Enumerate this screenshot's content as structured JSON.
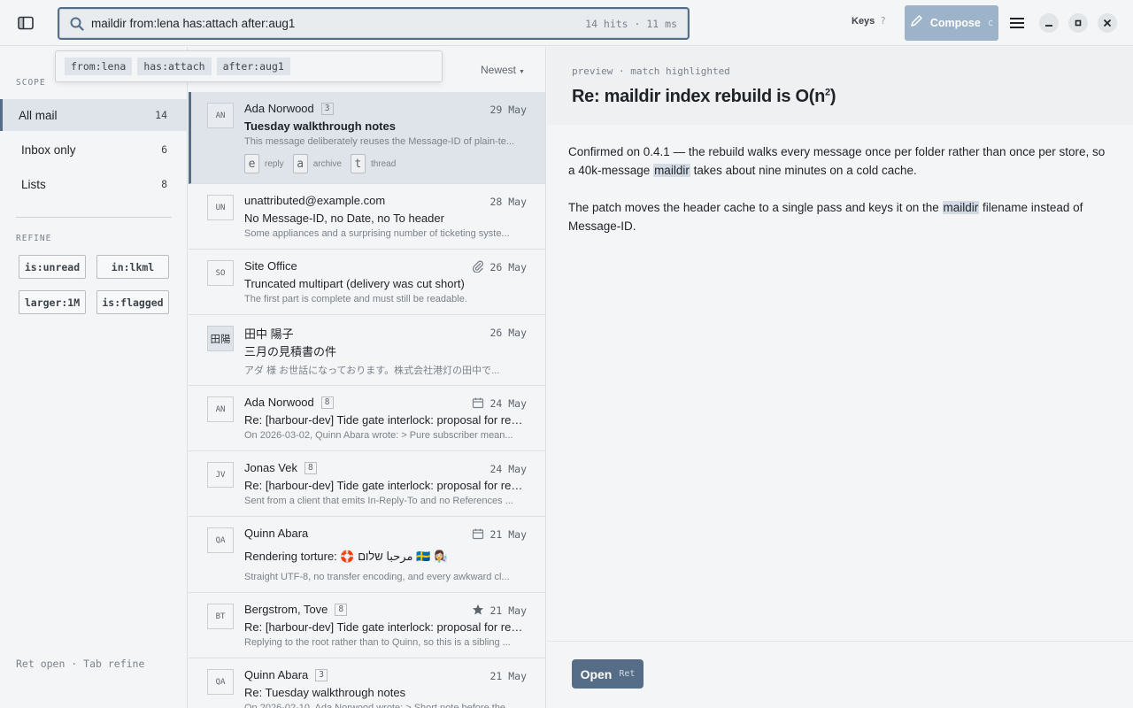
{
  "search": {
    "query": "maildir from:lena has:attach after:aug1",
    "stats": "14 hits · 11 ms",
    "suggestions": [
      "from:lena",
      "has:attach",
      "after:aug1"
    ]
  },
  "toolbar": {
    "keys_label": "Keys",
    "keys_hint": "?",
    "compose_label": "Compose",
    "compose_key": "c"
  },
  "sidebar": {
    "scope_label": "SCOPE",
    "scopes": [
      {
        "label": "All mail",
        "count": "14"
      },
      {
        "label": "Inbox only",
        "count": "6"
      },
      {
        "label": "Lists",
        "count": "8"
      }
    ],
    "refine_label": "REFINE",
    "refine_chips": [
      "is:unread",
      "in:lkml",
      "larger:1M",
      "is:flagged"
    ],
    "hint": "Ret open · Tab refine"
  },
  "list": {
    "sort_label": "Newest",
    "messages": [
      {
        "initials": "AN",
        "sender": "Ada Norwood",
        "thread_count": "3",
        "date": "29 May",
        "icon": "",
        "subject": "Tuesday walkthrough notes",
        "snippet": "This message deliberately reuses the Message-ID of plain-te...",
        "actions": [
          {
            "key": "e",
            "label": "reply"
          },
          {
            "key": "a",
            "label": "archive"
          },
          {
            "key": "t",
            "label": "thread"
          }
        ]
      },
      {
        "initials": "UN",
        "sender": "unattributed@example.com",
        "thread_count": "",
        "date": "28 May",
        "icon": "",
        "subject": "No Message-ID, no Date, no To header",
        "snippet": "Some appliances and a surprising number of ticketing syste..."
      },
      {
        "initials": "SO",
        "sender": "Site Office",
        "thread_count": "",
        "date": "26 May",
        "icon": "paperclip-icon",
        "subject": "Truncated multipart (delivery was cut short)",
        "snippet": "The first part is complete and must still be readable."
      },
      {
        "initials": "田陽",
        "sender": "田中 陽子",
        "thread_count": "",
        "date": "26 May",
        "icon": "",
        "subject": "三月の見積書の件",
        "snippet": "アダ 様 お世話になっております。株式会社港灯の田中で..."
      },
      {
        "initials": "AN",
        "sender": "Ada Norwood",
        "thread_count": "8",
        "date": "24 May",
        "icon": "calendar-icon",
        "subject": "Re: [harbour-dev] Tide gate interlock: proposal for revi...",
        "snippet": "On 2026-03-02, Quinn Abara wrote: > Pure subscriber mean..."
      },
      {
        "initials": "JV",
        "sender": "Jonas Vek",
        "thread_count": "8",
        "date": "24 May",
        "icon": "",
        "subject": "Re: [harbour-dev] Tide gate interlock: proposal for revi...",
        "snippet": "Sent from a client that emits In-Reply-To and no References ..."
      },
      {
        "initials": "QA",
        "sender": "Quinn Abara",
        "thread_count": "",
        "date": "21 May",
        "icon": "calendar-icon",
        "subject": "Rendering torture: 🛟 مرحبا שלום 🇸🇪 👩‍🔬",
        "snippet": "Straight UTF-8, no transfer encoding, and every awkward cl..."
      },
      {
        "initials": "BT",
        "sender": "Bergstrom, Tove",
        "thread_count": "8",
        "date": "21 May",
        "icon": "star-icon",
        "subject": "Re: [harbour-dev] Tide gate interlock: proposal for revi...",
        "snippet": "Replying to the root rather than to Quinn, so this is a sibling ..."
      },
      {
        "initials": "QA",
        "sender": "Quinn Abara",
        "thread_count": "3",
        "date": "21 May",
        "icon": "",
        "subject": "Re: Tuesday walkthrough notes",
        "snippet": "On 2026-02-10, Ada Norwood wrote: > Short note before the..."
      }
    ]
  },
  "preview": {
    "meta": "preview · match highlighted",
    "title_main": "Re: maildir index rebuild is O(n",
    "title_sup": "2",
    "title_end": ")",
    "p1_a": "Confirmed on 0.4.1 — the rebuild walks every message once per folder rather than once per store, so a 40k-message ",
    "p1_mark": "maildir",
    "p1_b": " takes about nine minutes on a cold cache.",
    "p2_a": "The patch moves the header cache to a single pass and keys it on the ",
    "p2_mark": "maildir",
    "p2_b": " filename instead of Message-ID.",
    "open_label": "Open",
    "open_key": "Ret"
  }
}
